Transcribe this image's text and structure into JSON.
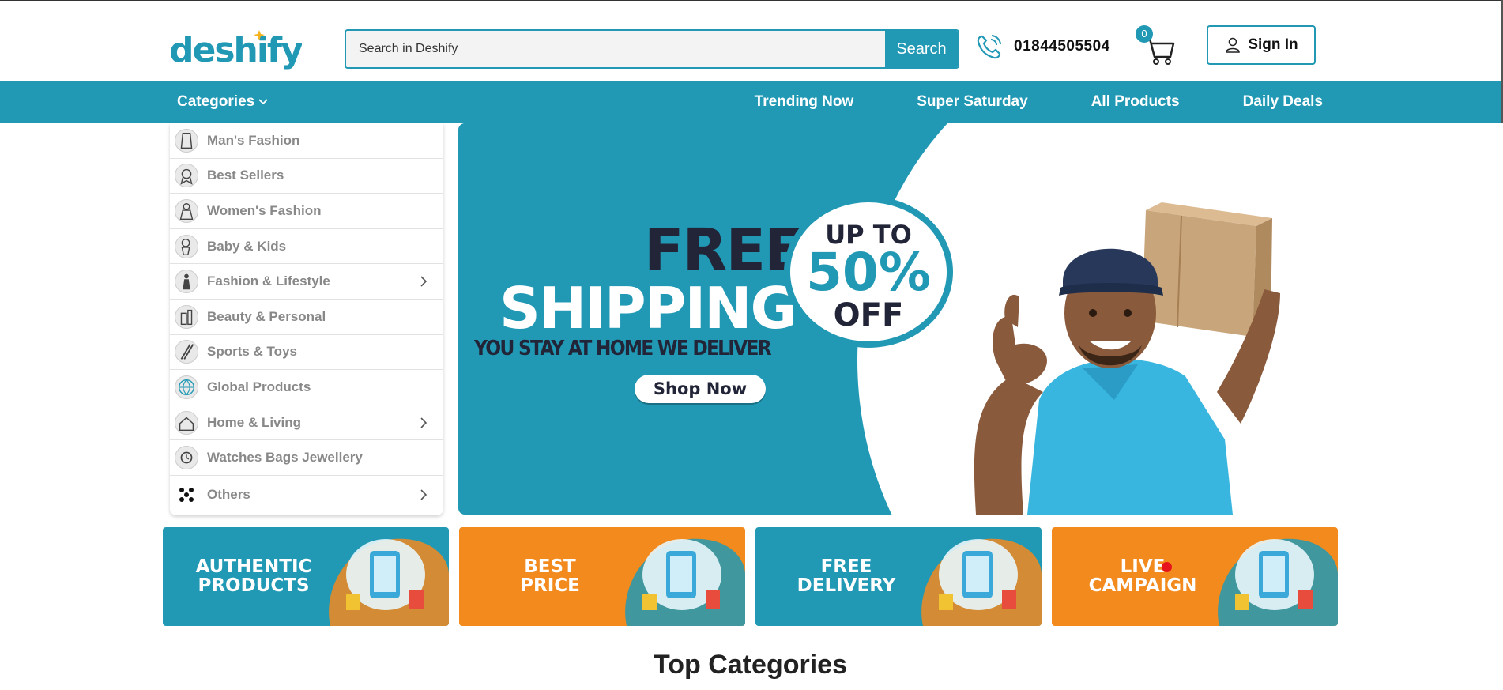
{
  "header": {
    "logo_text": "deshify",
    "search_placeholder": "Search in Deshify",
    "search_button": "Search",
    "phone": "01844505504",
    "cart_count": "0",
    "signin_label": "Sign In"
  },
  "navbar": {
    "categories_label": "Categories",
    "links": [
      "Trending Now",
      "Super Saturday",
      "All Products",
      "Daily Deals"
    ]
  },
  "sidebar": {
    "items": [
      {
        "label": "Man's Fashion",
        "icon": "mens-fashion-icon",
        "has_submenu": false
      },
      {
        "label": "Best Sellers",
        "icon": "best-sellers-icon",
        "has_submenu": false
      },
      {
        "label": "Women's Fashion",
        "icon": "womens-fashion-icon",
        "has_submenu": false
      },
      {
        "label": "Baby & Kids",
        "icon": "baby-kids-icon",
        "has_submenu": false
      },
      {
        "label": "Fashion & Lifestyle",
        "icon": "fashion-lifestyle-icon",
        "has_submenu": true
      },
      {
        "label": "Beauty & Personal",
        "icon": "beauty-icon",
        "has_submenu": false
      },
      {
        "label": "Sports & Toys",
        "icon": "sports-toys-icon",
        "has_submenu": false
      },
      {
        "label": "Global Products",
        "icon": "globe-icon",
        "has_submenu": false
      },
      {
        "label": "Home & Living",
        "icon": "home-living-icon",
        "has_submenu": true
      },
      {
        "label": "Watches Bags Jewellery",
        "icon": "watch-icon",
        "has_submenu": false
      },
      {
        "label": "Others",
        "icon": "others-icon",
        "has_submenu": true
      }
    ]
  },
  "banner": {
    "line1": "FREE",
    "line2": "SHIPPING",
    "tagline": "YOU STAY AT HOME WE DELIVER",
    "button": "Shop Now",
    "offer_up": "UP TO",
    "offer_pct": "50%",
    "offer_off": "OFF"
  },
  "features": [
    {
      "line1": "AUTHENTIC",
      "line2": "PRODUCTS",
      "color": "#2199b5"
    },
    {
      "line1": "BEST",
      "line2": "PRICE",
      "color": "#f28a1e"
    },
    {
      "line1": "FREE",
      "line2": "DELIVERY",
      "color": "#2199b5"
    },
    {
      "line1": "LIVE",
      "line2": "CAMPAIGN",
      "color": "#f28a1e"
    }
  ],
  "section_title": "Top Categories",
  "colors": {
    "brand": "#2199b5",
    "accent": "#f28a1e",
    "dark": "#222538"
  }
}
